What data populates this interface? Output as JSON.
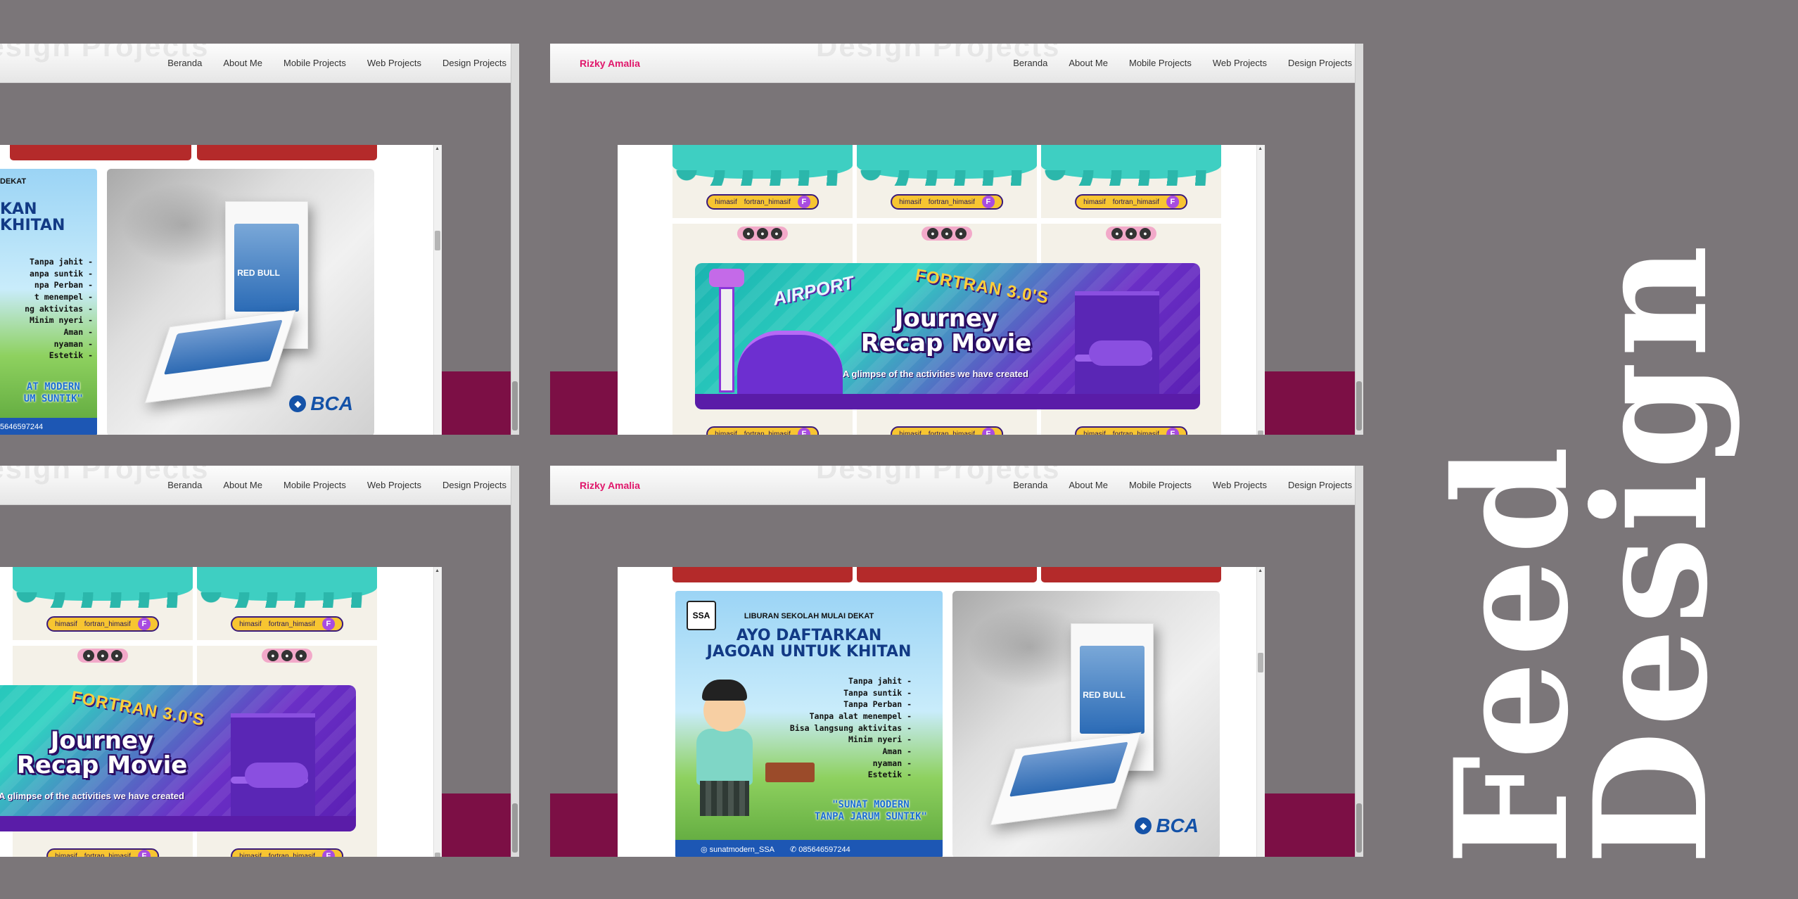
{
  "title_lines": [
    "Feed",
    "Design"
  ],
  "nav": {
    "brand": "Rizky Amalia",
    "ghost": "Design Projects",
    "items": [
      "Beranda",
      "About Me",
      "Mobile Projects",
      "Web Projects",
      "Design Projects"
    ]
  },
  "khitan": {
    "kicker": "LIBURAN SEKOLAH MULAI DEKAT",
    "kicker_short": "DEKAT",
    "headline1": "AYO DAFTARKAN",
    "headline2": "JAGOAN UNTUK KHITAN",
    "headline1_short": "KAN",
    "headline2_short": "KHITAN",
    "features": [
      "Tanpa jahit -",
      "Tanpa suntik -",
      "Tanpa Perban -",
      "Tanpa alat menempel -",
      "Bisa langsung aktivitas -",
      "Minim nyeri -",
      "Aman -",
      "nyaman -",
      "Estetik -"
    ],
    "features_short": [
      "Tanpa jahit -",
      "anpa suntik -",
      "npa Perban -",
      "t menempel -",
      "ng aktivitas -",
      "Minim nyeri -",
      "Aman -",
      "nyaman -",
      "Estetik -"
    ],
    "tagline1": "\"SUNAT MODERN",
    "tagline2": "TANPA JARUM SUNTIK\"",
    "tagline1_short": "AT MODERN",
    "tagline2_short": "UM SUNTIK\"",
    "instagram": "sunatmodern_SSA",
    "whatsapp": "085646597244",
    "whatsapp_short": "5646597244",
    "logo": "SSA"
  },
  "bca": {
    "brand": "BCA",
    "book_label": "RED BULL"
  },
  "fortran": {
    "handle1": "himasif",
    "handle2": "fortran_himasif",
    "badge": "F",
    "airport": "AIRPORT",
    "event": "FORTRAN 3.0'S",
    "title1": "Journey",
    "title2": "Recap Movie",
    "caption": "A glimpse of the activities we have created"
  },
  "colors": {
    "background": "#7b7679",
    "brand": "#e0176b",
    "band": "#7c0f45",
    "pill": "#f7c531"
  }
}
